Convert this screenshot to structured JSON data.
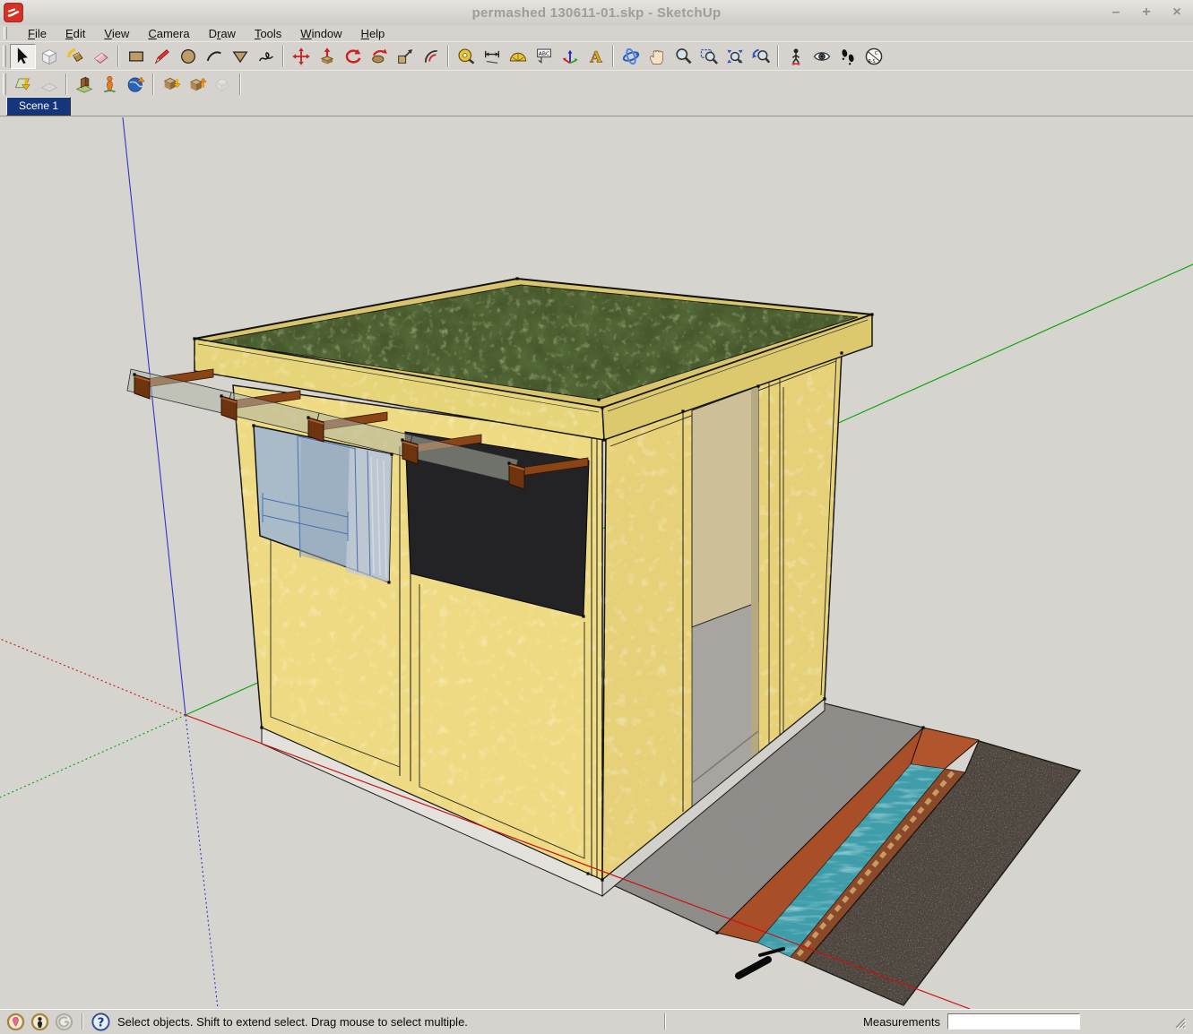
{
  "window": {
    "title": "permashed 130611-01.skp - SketchUp",
    "controls": {
      "minimize": "–",
      "maximize": "+",
      "close": "×"
    }
  },
  "menus": [
    {
      "label": "File",
      "mnemonic": 0
    },
    {
      "label": "Edit",
      "mnemonic": 0
    },
    {
      "label": "View",
      "mnemonic": 0
    },
    {
      "label": "Camera",
      "mnemonic": 0
    },
    {
      "label": "Draw",
      "mnemonic": 1
    },
    {
      "label": "Tools",
      "mnemonic": 0
    },
    {
      "label": "Window",
      "mnemonic": 0
    },
    {
      "label": "Help",
      "mnemonic": 0
    }
  ],
  "toolbars": {
    "main": [
      {
        "grip": true
      },
      {
        "tool": "select",
        "pressed": true
      },
      {
        "tool": "make-component"
      },
      {
        "tool": "paint-bucket"
      },
      {
        "tool": "eraser"
      },
      {
        "sep": true
      },
      {
        "tool": "rectangle"
      },
      {
        "tool": "line"
      },
      {
        "tool": "circle"
      },
      {
        "tool": "arc"
      },
      {
        "tool": "polygon"
      },
      {
        "tool": "freehand"
      },
      {
        "sep": true
      },
      {
        "tool": "move"
      },
      {
        "tool": "push-pull"
      },
      {
        "tool": "rotate"
      },
      {
        "tool": "follow-me"
      },
      {
        "tool": "scale"
      },
      {
        "tool": "offset"
      },
      {
        "sep": true
      },
      {
        "tool": "tape-measure"
      },
      {
        "tool": "dimension"
      },
      {
        "tool": "protractor"
      },
      {
        "tool": "text"
      },
      {
        "tool": "axes"
      },
      {
        "tool": "3d-text"
      },
      {
        "sep": true
      },
      {
        "tool": "orbit"
      },
      {
        "tool": "pan"
      },
      {
        "tool": "zoom"
      },
      {
        "tool": "zoom-window"
      },
      {
        "tool": "zoom-extents"
      },
      {
        "tool": "zoom-previous"
      },
      {
        "sep": true
      },
      {
        "tool": "position-camera"
      },
      {
        "tool": "look-around"
      },
      {
        "tool": "walk"
      },
      {
        "tool": "section-plane"
      }
    ],
    "google": [
      {
        "grip": true
      },
      {
        "tool": "get-current-view"
      },
      {
        "tool": "toggle-terrain",
        "disabled": true
      },
      {
        "sep": true
      },
      {
        "tool": "photo-textures"
      },
      {
        "tool": "place-figure"
      },
      {
        "tool": "google-earth"
      },
      {
        "sep": true
      },
      {
        "tool": "get-models"
      },
      {
        "tool": "share-model"
      },
      {
        "tool": "upload-model",
        "disabled": true
      },
      {
        "sep": true
      }
    ]
  },
  "scenes": [
    "Scene 1"
  ],
  "statusbar": {
    "icons": [
      "geolocation",
      "claim-credit",
      "sign-in"
    ],
    "help_icon": "help",
    "message": "Select objects. Shift to extend select. Drag mouse to select multiple.",
    "measurements_label": "Measurements",
    "measurements_value": ""
  },
  "ui_colors": {
    "chrome": "#d6d3ce",
    "scene_tab_blue": "#16367c",
    "title_text": "#9d9d9b",
    "logo_red": "#d93025"
  },
  "model": {
    "colors": {
      "background": "#d6d4cf",
      "roof_grass": "#47592c",
      "roof_rim": "#d8c46c",
      "fascia": "#e6d478",
      "fascia_right": "#dcc96e",
      "wall_front": "#eeda82",
      "wall_right": "#e6d078",
      "wall_interior": "#cdc098",
      "floor_interior": "#a8a5a0",
      "opening_dark": "#232325",
      "window_glass": "#a9bac9",
      "awning_glass": "rgba(174,178,165,0.55)",
      "rafter_brown": "#8a4416",
      "rafter_cap": "#6e3410",
      "foundation": "#e3e1dc",
      "concrete": "#8f8d89",
      "channel_rust": "#a84e28",
      "channel_end": "#b0552c",
      "water": "#3f9daa",
      "brick_edge": "#8a4a2a",
      "gravel": "#585049",
      "axis_red": "#cc1111",
      "axis_green": "#00a400",
      "axis_blue": "#3333cc"
    }
  }
}
